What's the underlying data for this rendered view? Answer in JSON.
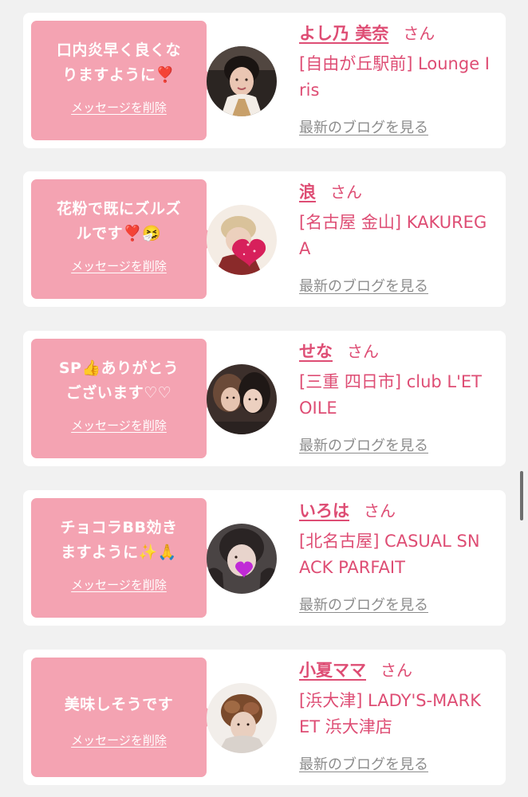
{
  "entries": [
    {
      "message": "口内炎早く良くな\nりますように❣️",
      "delete_label": "メッセージを削除",
      "name": "よし乃 美奈",
      "honorific": "さん",
      "shop": "[自由が丘駅前] Lounge Iris",
      "blog_label": "最新のブログを見る"
    },
    {
      "message": "花粉で既にズルズ\nルです❣️🤧",
      "delete_label": "メッセージを削除",
      "name": "浪",
      "honorific": "さん",
      "shop": "[名古屋 金山] KAKUREGA",
      "blog_label": "最新のブログを見る"
    },
    {
      "message": "SP👍ありがとう\nございます♡♡",
      "delete_label": "メッセージを削除",
      "name": "せな",
      "honorific": "さん",
      "shop": "[三重 四日市] club L'ETOILE",
      "blog_label": "最新のブログを見る"
    },
    {
      "message": "チョコラBB効き\nますように✨🙏",
      "delete_label": "メッセージを削除",
      "name": "いろは",
      "honorific": "さん",
      "shop": "[北名古屋] CASUAL SNACK PARFAIT",
      "blog_label": "最新のブログを見る"
    },
    {
      "message": "美味しそうです",
      "delete_label": "メッセージを削除",
      "name": "小夏ママ",
      "honorific": "さん",
      "shop": "[浜大津] LADY'S-MARKET 浜大津店",
      "blog_label": "最新のブログを見る"
    }
  ],
  "colors": {
    "background": "#f1f1f1",
    "card": "#ffffff",
    "bubble": "#f4a3b2",
    "accent_text": "#de4d74",
    "link_gray": "#8c8c8c"
  },
  "icons": [
    "avatar-photo-1",
    "avatar-photo-2-heart-sticker",
    "avatar-photo-3",
    "avatar-photo-4-heart-sticker",
    "avatar-photo-5"
  ]
}
